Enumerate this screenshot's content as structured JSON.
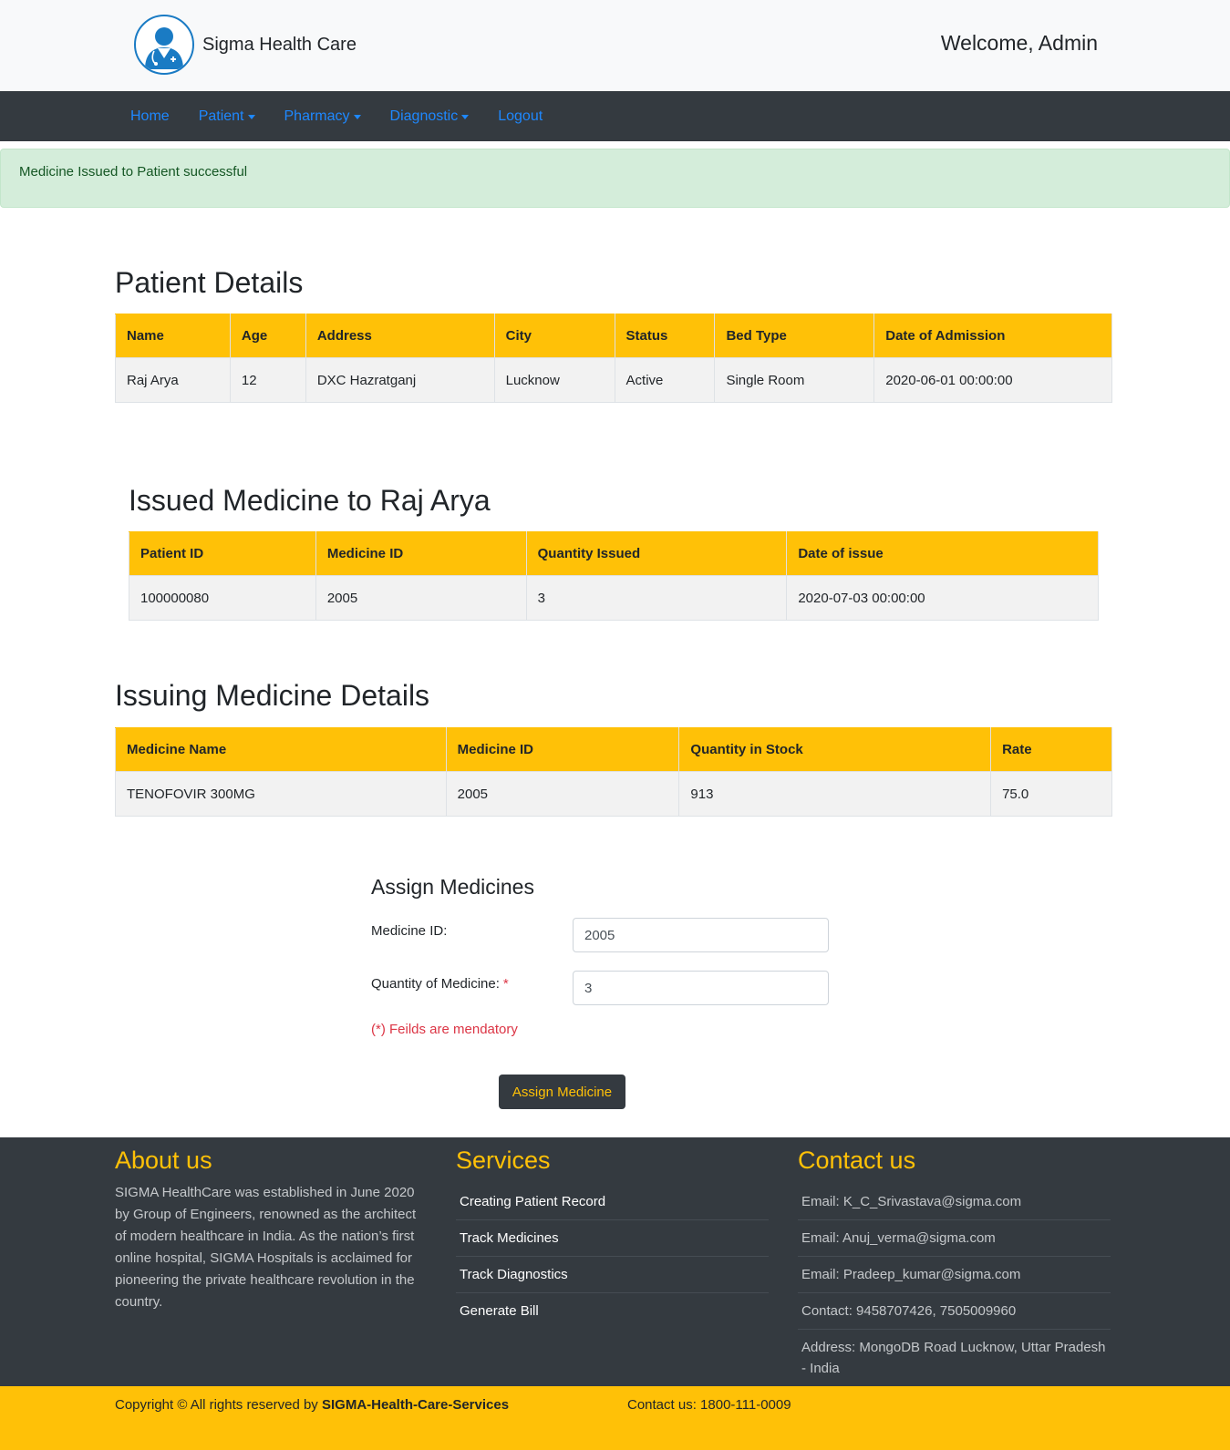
{
  "brand": {
    "name": "Sigma Health Care",
    "logo_icon": "doctor-icon"
  },
  "header": {
    "welcome": "Welcome, Admin"
  },
  "nav": {
    "home": "Home",
    "patient": "Patient",
    "pharmacy": "Pharmacy",
    "diagnostic": "Diagnostic",
    "logout": "Logout"
  },
  "alert": {
    "message": "Medicine Issued to Patient successful"
  },
  "patient_details": {
    "title": "Patient Details",
    "columns": [
      "Name",
      "Age",
      "Address",
      "City",
      "Status",
      "Bed Type",
      "Date of Admission"
    ],
    "row": [
      "Raj Arya",
      "12",
      "DXC Hazratganj",
      "Lucknow",
      "Active",
      "Single Room",
      "2020-06-01 00:00:00"
    ]
  },
  "issued_medicine": {
    "title": "Issued Medicine to Raj Arya",
    "columns": [
      "Patient ID",
      "Medicine ID",
      "Quantity Issued",
      "Date of issue"
    ],
    "row": [
      "100000080",
      "2005",
      "3",
      "2020-07-03 00:00:00"
    ]
  },
  "issuing_medicine": {
    "title": "Issuing Medicine Details",
    "columns": [
      "Medicine Name",
      "Medicine ID",
      "Quantity in Stock",
      "Rate"
    ],
    "row": [
      "TENOFOVIR 300MG",
      "2005",
      "913",
      "75.0"
    ]
  },
  "assign_form": {
    "title": "Assign Medicines",
    "medicine_id_label": "Medicine ID:",
    "medicine_id_value": "2005",
    "quantity_label": "Quantity of Medicine:",
    "required_mark": "*",
    "quantity_value": "3",
    "mandatory_note": "(*) Feilds are mendatory",
    "submit_label": "Assign Medicine"
  },
  "footer": {
    "about": {
      "title": "About us",
      "text": "SIGMA HealthCare was established in June 2020 by Group of Engineers, renowned as the architect of modern healthcare in India. As the nation’s first online hospital, SIGMA Hospitals is acclaimed for pioneering the private healthcare revolution in the country."
    },
    "services": {
      "title": "Services",
      "items": [
        "Creating Patient Record",
        "Track Medicines",
        "Track Diagnostics",
        "Generate Bill"
      ]
    },
    "contact": {
      "title": "Contact us",
      "items": [
        "Email: K_C_Srivastava@sigma.com",
        "Email: Anuj_verma@sigma.com",
        "Email: Pradeep_kumar@sigma.com",
        "Contact: 9458707426, 7505009960",
        "Address: MongoDB Road Lucknow, Uttar Pradesh - India"
      ]
    }
  },
  "copyright": {
    "prefix": "Copyright © All rights reserved by ",
    "company": "SIGMA-Health-Care-Services",
    "contact": "Contact us: 1800-111-0009"
  },
  "colors": {
    "accent": "#ffc107",
    "dark": "#343a40",
    "link": "#1e88ff",
    "success_bg": "#d4edda",
    "danger": "#dc3545"
  }
}
